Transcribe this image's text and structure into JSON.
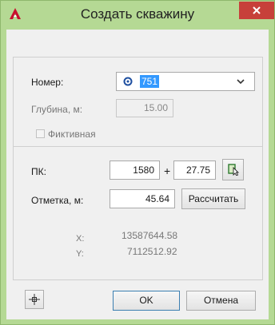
{
  "window": {
    "title": "Создать скважину",
    "app_icon": "autocad-a-icon",
    "close_icon": "close-icon"
  },
  "form": {
    "number_label": "Номер:",
    "number_value": "751",
    "number_icon": "target-icon",
    "dropdown_icon": "chevron-down-icon",
    "depth_label": "Глубина, м:",
    "depth_value": "15.00",
    "fictive_label": "Фиктивная",
    "fictive_checked": false,
    "pk_label": "ПК:",
    "pk_value": "1580",
    "pk_plus": "+",
    "pk_offset": "27.75",
    "pick_icon": "pick-point-icon",
    "elevation_label": "Отметка, м:",
    "elevation_value": "45.64",
    "calculate_button": "Рассчитать",
    "x_label": "X:",
    "x_value": "13587644.58",
    "y_label": "Y:",
    "y_value": "7112512.92"
  },
  "footer": {
    "crosshair_icon": "crosshair-icon",
    "ok_button": "OK",
    "cancel_button": "Отмена"
  }
}
